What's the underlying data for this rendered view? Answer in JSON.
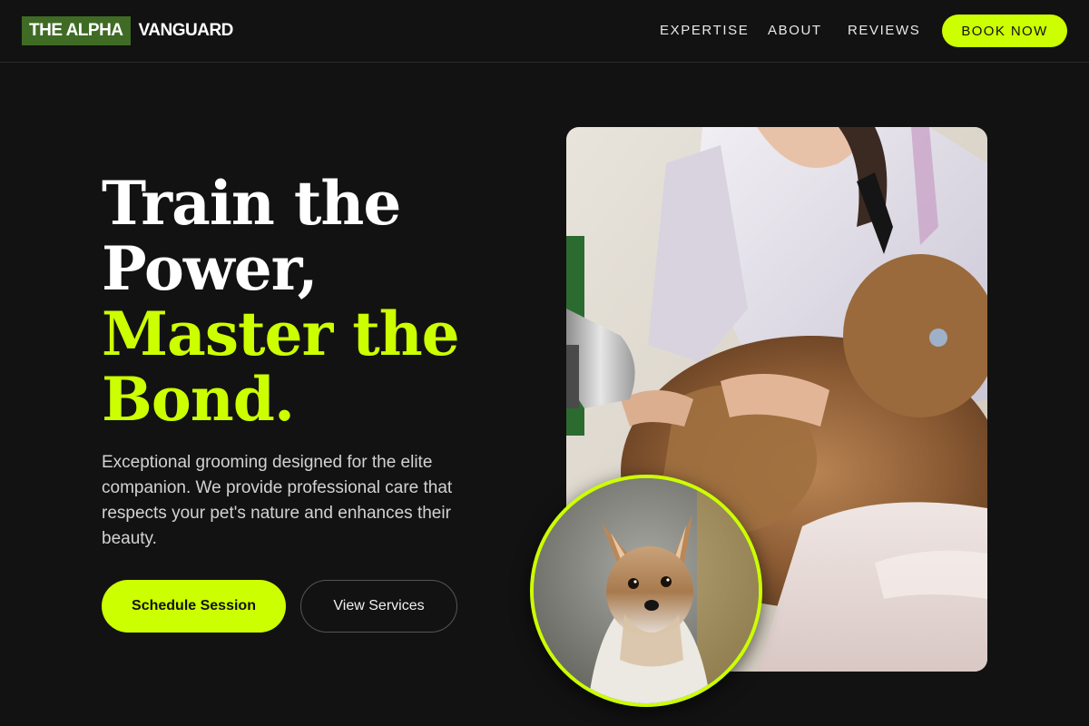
{
  "brand": {
    "logo_highlight": "THE ALPHA",
    "logo_rest": "VANGUARD",
    "accent_color": "#ccff00",
    "logo_box_color": "#3f6b25"
  },
  "nav": {
    "links": [
      "EXPERTISE",
      "ABOUT",
      "REVIEWS"
    ],
    "cta": "BOOK NOW"
  },
  "hero": {
    "title_line1": "Train the",
    "title_line2": "Power,",
    "title_line3": "Master the",
    "title_line4": "Bond.",
    "description": "Exceptional grooming designed for the elite companion. We provide professional care that respects your pet's nature and enhances their beauty.",
    "primary_button": "Schedule Session",
    "secondary_button": "View Services"
  },
  "images": {
    "main_photo_icon": "groomer-drying-dog-photo",
    "circle_photo_icon": "yorkshire-terrier-photo"
  }
}
